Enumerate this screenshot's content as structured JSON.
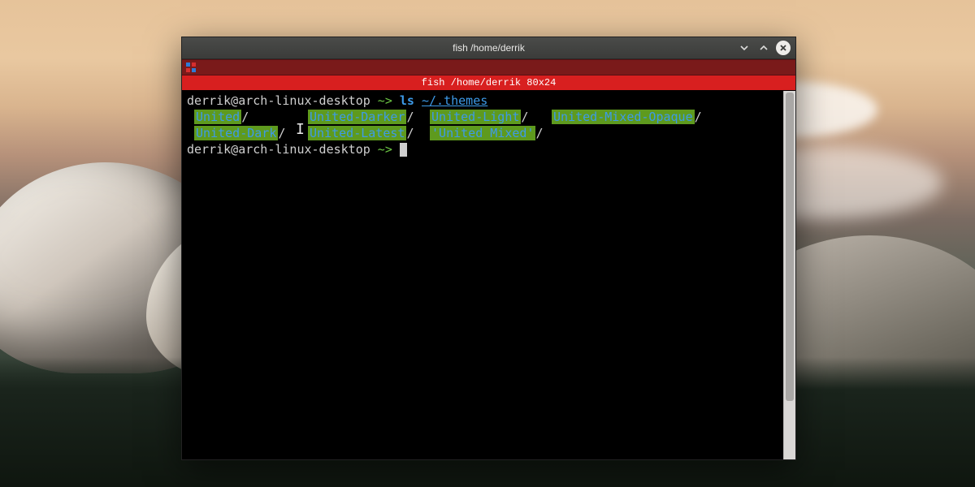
{
  "window": {
    "title": "fish /home/derrik"
  },
  "tab": {
    "label": "fish  /home/derrik 80x24"
  },
  "prompt": {
    "userhost": "derrik@arch-linux-desktop",
    "tilde_arrow": " ~> "
  },
  "cmd1": {
    "cmd": "ls",
    "arg": "~/.themes"
  },
  "ls": {
    "row1": {
      "c1": "United",
      "c2": "United-Darker",
      "c3": "United-Light",
      "c4": "United-Mixed-Opaque"
    },
    "row2": {
      "c1": "United-Dark",
      "c2": "United-Latest",
      "c3": "'United Mixed'"
    }
  },
  "slash": "/",
  "colwidths": {
    "c1": "140px",
    "c2": "150px",
    "c3": "150px",
    "c4": "auto"
  }
}
